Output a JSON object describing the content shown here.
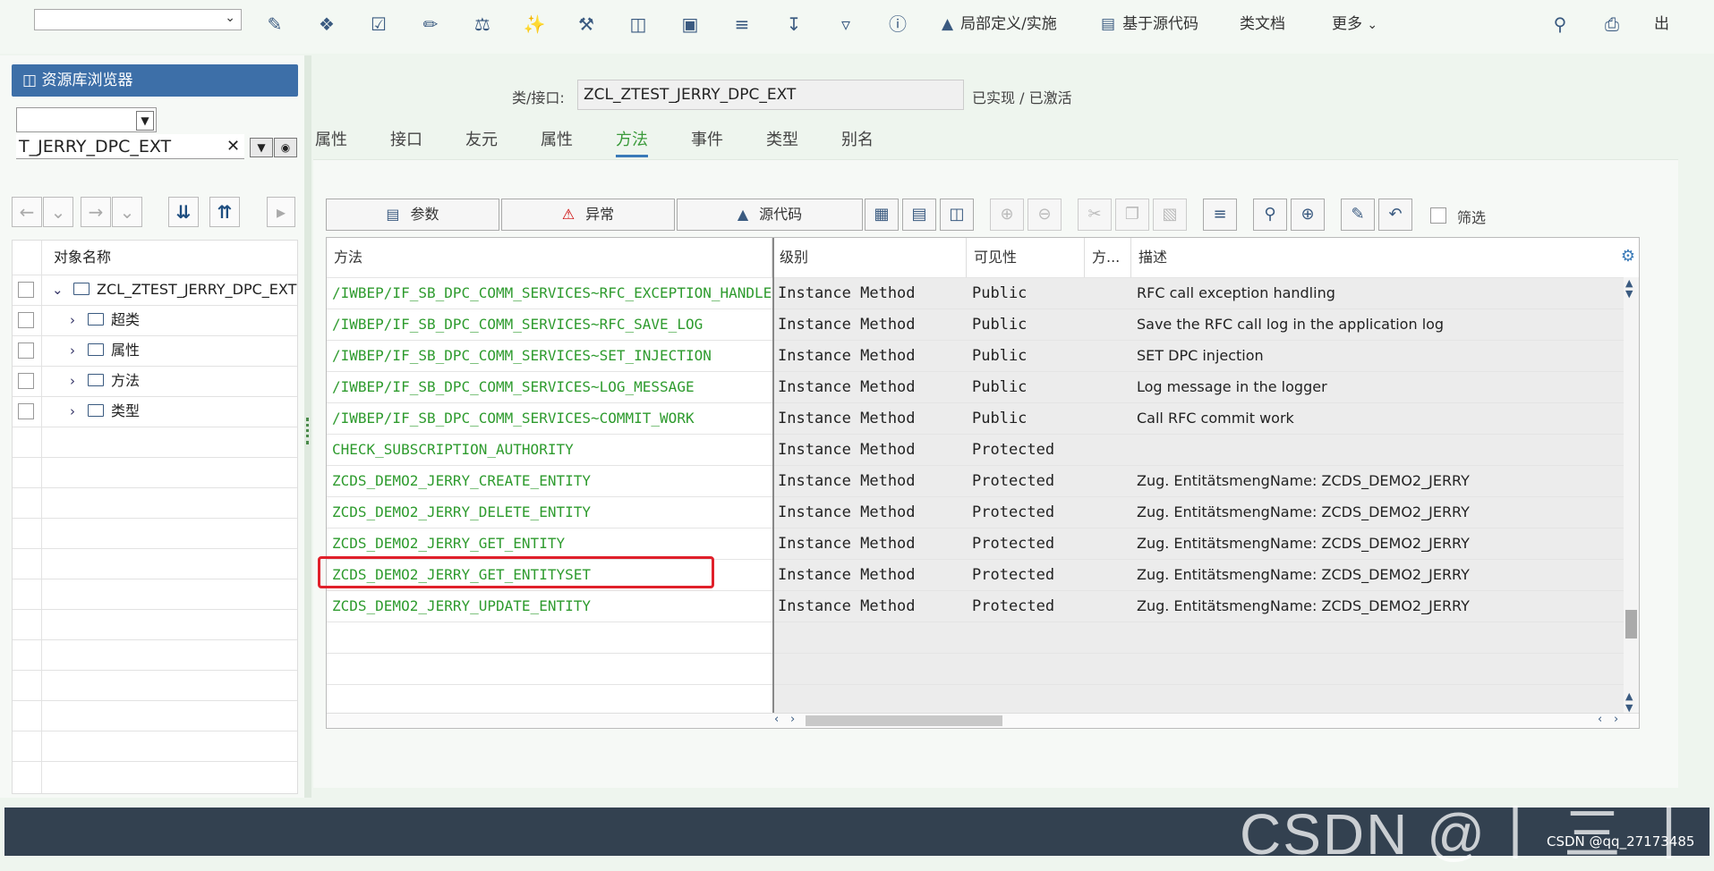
{
  "toolbar": {
    "select_value": "",
    "items": [
      {
        "icon": "edit-toggle-icon"
      },
      {
        "icon": "object-list-icon"
      },
      {
        "icon": "check-icon"
      },
      {
        "icon": "pencil-icon"
      },
      {
        "icon": "scale-icon"
      },
      {
        "icon": "magic-wand-icon"
      },
      {
        "icon": "hammer-icon"
      },
      {
        "icon": "hierarchy-icon"
      },
      {
        "icon": "tree-icon"
      },
      {
        "icon": "stack-icon"
      },
      {
        "icon": "where-used-icon"
      },
      {
        "icon": "filter-icon"
      },
      {
        "icon": "info-icon"
      }
    ],
    "local_def_label": "局部定义/实施",
    "source_based_label": "基于源代码",
    "class_doc_label": "类文档",
    "more_label": "更多",
    "exit_label": "出"
  },
  "sidebar": {
    "header": "资源库浏览器",
    "select_value": "",
    "input_value": "T_JERRY_DPC_EXT",
    "column_header": "对象名称",
    "tree": [
      {
        "label": "ZCL_ZTEST_JERRY_DPC_EXT",
        "level": 0
      },
      {
        "label": "超类",
        "level": 1
      },
      {
        "label": "属性",
        "level": 1
      },
      {
        "label": "方法",
        "level": 1
      },
      {
        "label": "类型",
        "level": 1
      }
    ]
  },
  "main": {
    "class_label": "类/接口:",
    "class_name": "ZCL_ZTEST_JERRY_DPC_EXT",
    "class_status": "已实现 / 已激活",
    "tabs": [
      {
        "label": "属性",
        "active": false
      },
      {
        "label": "接口",
        "active": false
      },
      {
        "label": "友元",
        "active": false
      },
      {
        "label": "属性",
        "active": false
      },
      {
        "label": "方法",
        "active": true
      },
      {
        "label": "事件",
        "active": false
      },
      {
        "label": "类型",
        "active": false
      },
      {
        "label": "别名",
        "active": false
      }
    ],
    "buttons": {
      "params": "参数",
      "exceptions": "异常",
      "source": "源代码"
    },
    "filter_label": "筛选",
    "table": {
      "headers": {
        "method": "方法",
        "level": "级别",
        "visibility": "可见性",
        "method_type": "方...",
        "description": "描述"
      },
      "rows": [
        {
          "method": "/IWBEP/IF_SB_DPC_COMM_SERVICES~RFC_EXCEPTION_HANDLER",
          "level": "Instance Method",
          "visibility": "Public",
          "description": "RFC call exception handling"
        },
        {
          "method": "/IWBEP/IF_SB_DPC_COMM_SERVICES~RFC_SAVE_LOG",
          "level": "Instance Method",
          "visibility": "Public",
          "description": "Save the RFC call log in the application log"
        },
        {
          "method": "/IWBEP/IF_SB_DPC_COMM_SERVICES~SET_INJECTION",
          "level": "Instance Method",
          "visibility": "Public",
          "description": "SET DPC injection"
        },
        {
          "method": "/IWBEP/IF_SB_DPC_COMM_SERVICES~LOG_MESSAGE",
          "level": "Instance Method",
          "visibility": "Public",
          "description": "Log message in the logger"
        },
        {
          "method": "/IWBEP/IF_SB_DPC_COMM_SERVICES~COMMIT_WORK",
          "level": "Instance Method",
          "visibility": "Public",
          "description": "Call RFC commit work"
        },
        {
          "method": "CHECK_SUBSCRIPTION_AUTHORITY",
          "level": "Instance Method",
          "visibility": "Protected",
          "description": ""
        },
        {
          "method": "ZCDS_DEMO2_JERRY_CREATE_ENTITY",
          "level": "Instance Method",
          "visibility": "Protected",
          "description": "Zug. EntitätsmengName:  ZCDS_DEMO2_JERRY"
        },
        {
          "method": "ZCDS_DEMO2_JERRY_DELETE_ENTITY",
          "level": "Instance Method",
          "visibility": "Protected",
          "description": "Zug. EntitätsmengName:  ZCDS_DEMO2_JERRY"
        },
        {
          "method": "ZCDS_DEMO2_JERRY_GET_ENTITY",
          "level": "Instance Method",
          "visibility": "Protected",
          "description": "Zug. EntitätsmengName:  ZCDS_DEMO2_JERRY"
        },
        {
          "method": "ZCDS_DEMO2_JERRY_GET_ENTITYSET",
          "level": "Instance Method",
          "visibility": "Protected",
          "description": "Zug. EntitätsmengName:  ZCDS_DEMO2_JERRY"
        },
        {
          "method": "ZCDS_DEMO2_JERRY_UPDATE_ENTITY",
          "level": "Instance Method",
          "visibility": "Protected",
          "description": "Zug. EntitätsmengName:  ZCDS_DEMO2_JERRY"
        }
      ]
    }
  },
  "watermark": {
    "large": "CSDN @丨 三 丨",
    "small": "CSDN @qq_27173485"
  },
  "colors": {
    "method_green": "#2e9b2e",
    "header_blue": "#3d6fa8",
    "highlight_red": "#e0202a",
    "footer_dark": "#334150"
  }
}
